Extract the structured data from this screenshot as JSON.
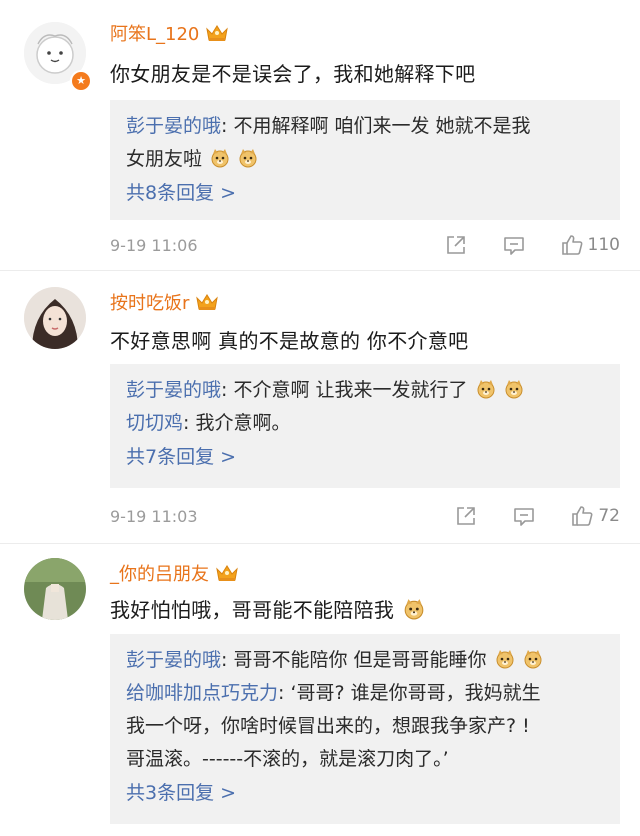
{
  "comments": [
    {
      "username": "阿笨L_120",
      "text": "你女朋友是不是误会了，我和她解释下吧",
      "replies": [
        {
          "name": "彭于晏的哦",
          "sep": ": ",
          "text": "不用解释啊 咱们来一发 她就不是我",
          "text2": "女朋友啦"
        }
      ],
      "more": "共8条回复 >",
      "time": "9-19 11:06",
      "likes": "110"
    },
    {
      "username": "按时吃饭r",
      "text": "不好意思啊  真的不是故意的  你不介意吧",
      "replies": [
        {
          "name": "彭于晏的哦",
          "sep": ": ",
          "text": "不介意啊 让我来一发就行了"
        },
        {
          "name": "切切鸡",
          "sep": ": ",
          "text": "我介意啊。"
        }
      ],
      "more": "共7条回复 >",
      "time": "9-19 11:03",
      "likes": "72"
    },
    {
      "username": "_你的吕朋友",
      "text": "我好怕怕哦，哥哥能不能陪陪我",
      "replies": [
        {
          "name": "彭于晏的哦",
          "sep": ": ",
          "text": "哥哥不能陪你 但是哥哥能睡你"
        },
        {
          "name": "给咖啡加点巧克力",
          "sep": ": ",
          "text": "‘哥哥? 谁是你哥哥，我妈就生",
          "text2": "我一个呀，你啥时候冒出来的，想跟我争家产? !",
          "text3": "哥温滚。------不滚的，就是滚刀肉了。’"
        }
      ],
      "more": "共3条回复 >",
      "time": "",
      "likes": ""
    }
  ],
  "icons": {
    "crown": "vip-crown-icon",
    "share": "share-icon",
    "comment": "comment-icon",
    "like": "thumb-up-icon",
    "emoji": "doge-emoji-icon"
  },
  "colors": {
    "username": "#e8741b",
    "reply_name": "#4b6fae",
    "reply_bg": "#f1f1f1",
    "meta": "#9b9b9b"
  }
}
